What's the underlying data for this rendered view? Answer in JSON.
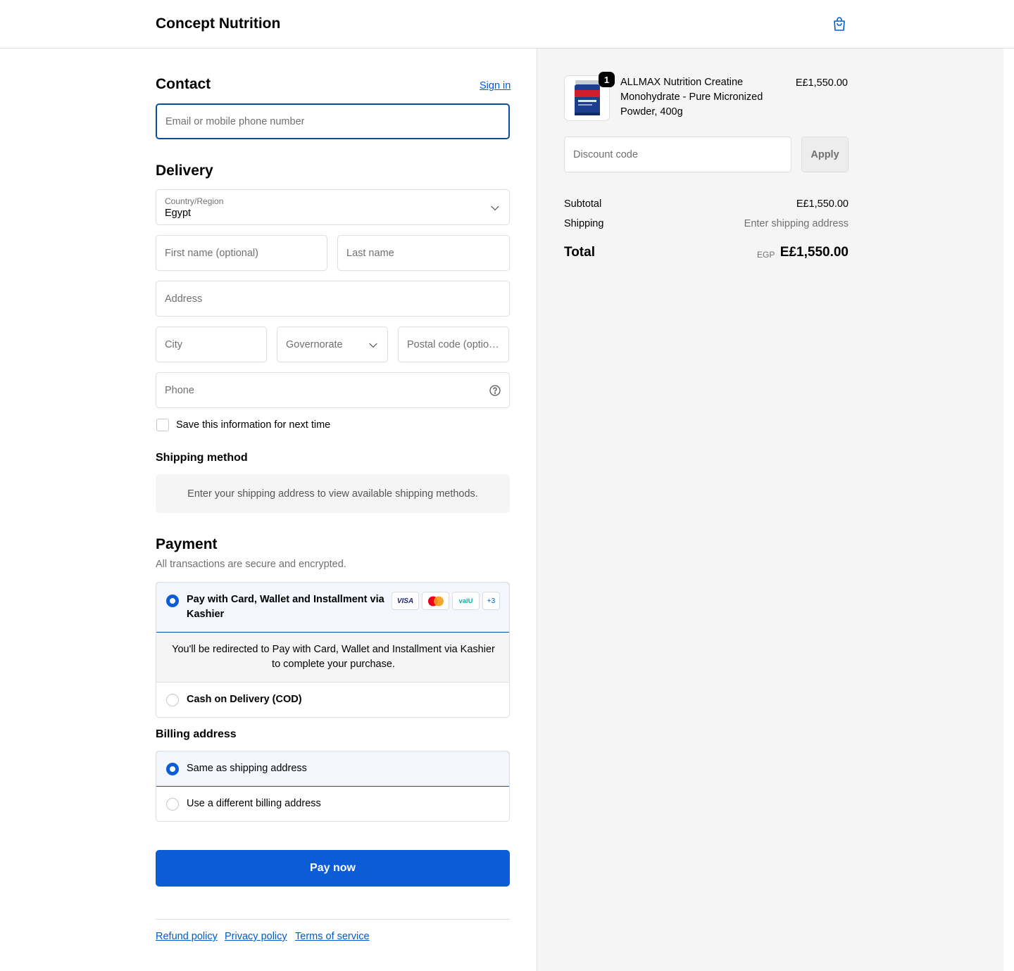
{
  "header": {
    "brand": "Concept Nutrition",
    "cart_icon": "shopping-bag-icon"
  },
  "contact": {
    "title": "Contact",
    "sign_in": "Sign in",
    "email_placeholder": "Email or mobile phone number"
  },
  "delivery": {
    "title": "Delivery",
    "country_label": "Country/Region",
    "country_value": "Egypt",
    "first_name_placeholder": "First name (optional)",
    "last_name_placeholder": "Last name",
    "address_placeholder": "Address",
    "city_placeholder": "City",
    "governorate_placeholder": "Governorate",
    "postal_placeholder": "Postal code (optional)",
    "phone_placeholder": "Phone",
    "save_info": "Save this information for next time"
  },
  "shipping_method": {
    "title": "Shipping method",
    "notice": "Enter your shipping address to view available shipping methods."
  },
  "payment": {
    "title": "Payment",
    "subtitle": "All transactions are secure and encrypted.",
    "option_kashier": "Pay with Card, Wallet and Installment via Kashier",
    "cards": [
      "VISA",
      "",
      "valU",
      "+3"
    ],
    "redirect_notice": "You'll be redirected to Pay with Card, Wallet and Installment via Kashier to complete your purchase.",
    "option_cod": "Cash on Delivery (COD)"
  },
  "billing": {
    "title": "Billing address",
    "same": "Same as shipping address",
    "different": "Use a different billing address"
  },
  "pay_now": "Pay now",
  "footer": {
    "links": [
      "Refund policy",
      "Privacy policy",
      "Terms of service"
    ]
  },
  "summary": {
    "product_name": "ALLMAX Nutrition Creatine Monohydrate - Pure Micronized Powder, 400g",
    "quantity": "1",
    "product_price": "E£1,550.00",
    "discount_placeholder": "Discount code",
    "apply": "Apply",
    "subtotal_label": "Subtotal",
    "subtotal_value": "E£1,550.00",
    "shipping_label": "Shipping",
    "shipping_value": "Enter shipping address",
    "total_label": "Total",
    "currency": "EGP",
    "total_value": "E£1,550.00"
  },
  "colors": {
    "accent": "#005bd1",
    "button": "#0b5cd5"
  }
}
